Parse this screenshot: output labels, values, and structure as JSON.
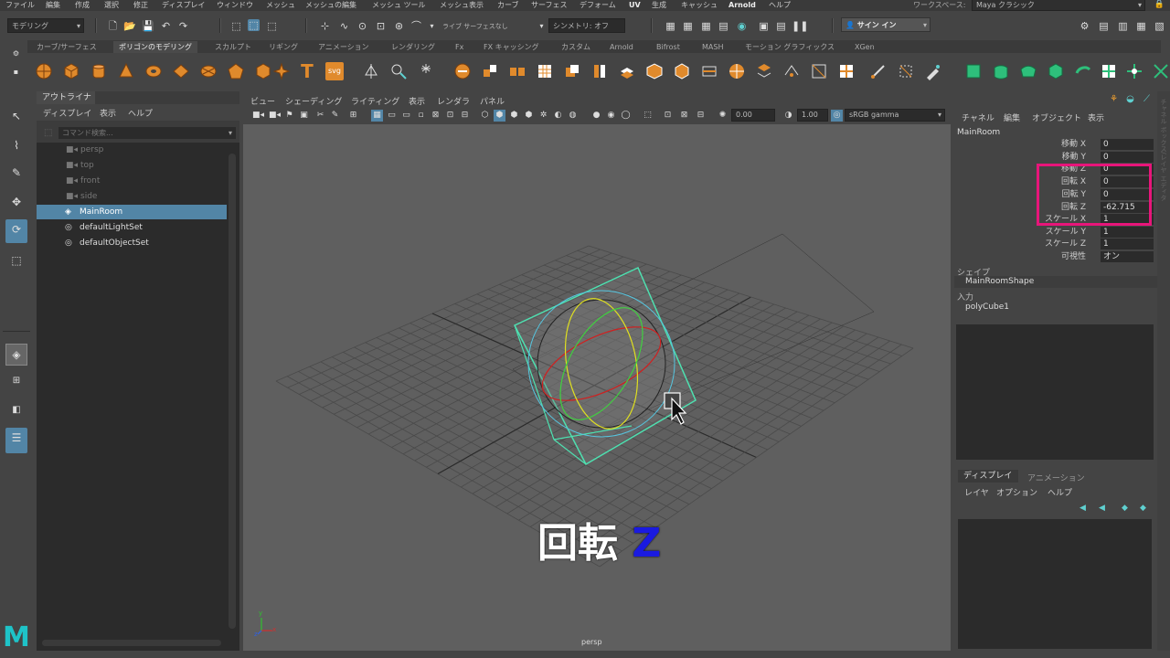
{
  "menu": {
    "items": [
      "ファイル",
      "編集",
      "作成",
      "選択",
      "修正",
      "ディスプレイ",
      "ウィンドウ",
      "メッシュ",
      "メッシュの編集",
      "メッシュ ツール",
      "メッシュ表示",
      "カーブ",
      "サーフェス",
      "デフォーム",
      "UV",
      "生成",
      "キャッシュ",
      "Arnold",
      "ヘルプ"
    ],
    "workspace_label": "ワークスペース:",
    "workspace_value": "Maya クラシック"
  },
  "status": {
    "mode": "モデリング",
    "live": "ライブ サーフェスなし",
    "symmetry": "シンメトリ: オフ",
    "signin": "サイン イン"
  },
  "shelf": {
    "tabs": [
      "カーブ/サーフェス",
      "ポリゴンのモデリング",
      "スカルプト",
      "リギング",
      "アニメーション",
      "レンダリング",
      "Fx",
      "FX キャッシング",
      "カスタム",
      "Arnold",
      "Bifrost",
      "MASH",
      "モーション グラフィックス",
      "XGen"
    ],
    "active_tab": "ポリゴンのモデリング",
    "text_icons": {
      "t": "T",
      "svg": "svg"
    }
  },
  "outliner": {
    "title": "アウトライナ",
    "menu": [
      "ディスプレイ",
      "表示",
      "ヘルプ"
    ],
    "search_placeholder": "コマンド検索...",
    "items": [
      {
        "label": "persp",
        "kind": "camera",
        "selected": false
      },
      {
        "label": "top",
        "kind": "camera",
        "selected": false
      },
      {
        "label": "front",
        "kind": "camera",
        "selected": false
      },
      {
        "label": "side",
        "kind": "camera",
        "selected": false
      },
      {
        "label": "MainRoom",
        "kind": "transform",
        "selected": true
      },
      {
        "label": "defaultLightSet",
        "kind": "set",
        "selected": false
      },
      {
        "label": "defaultObjectSet",
        "kind": "set",
        "selected": false
      }
    ]
  },
  "viewport": {
    "menu": [
      "ビュー",
      "シェーディング",
      "ライティング",
      "表示",
      "レンダラ",
      "パネル"
    ],
    "exposure": "0.00",
    "gamma": "1.00",
    "colorspace": "sRGB gamma",
    "camera_label": "persp",
    "overlay_text": "回転",
    "overlay_axis": "Z",
    "overlay_axis_color": "#1a1ae0",
    "axis_x": "x",
    "axis_y": "y",
    "axis_z": "z"
  },
  "channelbox": {
    "menu": [
      "チャネル",
      "編集",
      "オブジェクト",
      "表示"
    ],
    "object_name": "MainRoom",
    "attributes": [
      {
        "label": "移動 X",
        "value": "0"
      },
      {
        "label": "移動 Y",
        "value": "0"
      },
      {
        "label": "移動 Z",
        "value": "0"
      },
      {
        "label": "回転 X",
        "value": "0"
      },
      {
        "label": "回転 Y",
        "value": "0"
      },
      {
        "label": "回転 Z",
        "value": "-62.715"
      },
      {
        "label": "スケール X",
        "value": "1"
      },
      {
        "label": "スケール Y",
        "value": "1"
      },
      {
        "label": "スケール Z",
        "value": "1"
      },
      {
        "label": "可視性",
        "value": "オン"
      }
    ],
    "shape_header": "シェイプ",
    "shape_name": "MainRoomShape",
    "input_header": "入力",
    "input_name": "polyCube1",
    "highlight_color": "#e8157a",
    "side_tab_text": "チャネル ボックス/レイヤ エディタ"
  },
  "layers": {
    "tabs": [
      "ディスプレイ",
      "アニメーション"
    ],
    "menu": [
      "レイヤ",
      "オプション",
      "ヘルプ"
    ]
  },
  "accent_color": "#5285a6"
}
